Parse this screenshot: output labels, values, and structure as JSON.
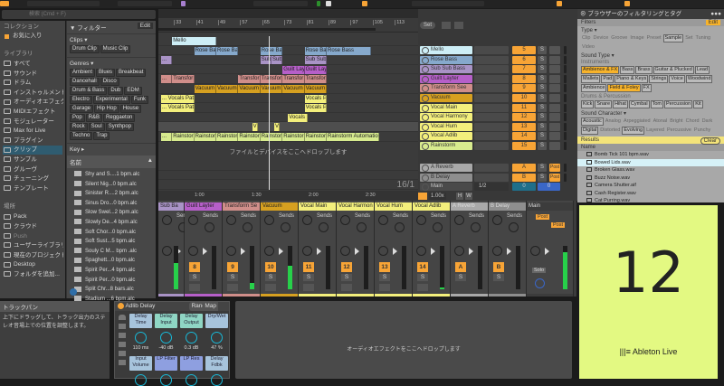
{
  "search": {
    "placeholder": "検索 (Cmd + F)"
  },
  "sidebar": {
    "collections_header": "コレクション",
    "favorites": "お気に入り",
    "library_header": "ライブラリ",
    "library": [
      "すべて",
      "サウンド",
      "ドラム",
      "インストゥルメント",
      "オーディオエフェクト",
      "MIDIエフェクト",
      "モジュレーター",
      "Max for Live",
      "プラグイン",
      "クリップ",
      "サンプル",
      "グルーヴ",
      "チューニング",
      "テンプレート"
    ],
    "selected": "クリップ",
    "places_header": "場所",
    "places": [
      "Pack",
      "クラウド",
      "Push",
      "ユーザーライブラリ",
      "現在のプロジェクト",
      "Desktop",
      "フォルダを追加..."
    ]
  },
  "filter": {
    "title": "フィルター",
    "edit": "Edit",
    "clips_label": "Clips",
    "clips": [
      "Drum Clip",
      "Music Clip"
    ],
    "genres_label": "Genres",
    "genres": [
      "Ambient",
      "Blues",
      "Breakbeat",
      "Dancehall",
      "Disco",
      "Drum & Bass",
      "Dub",
      "EDM",
      "Electro",
      "Experimental",
      "Funk",
      "Garage",
      "Hip Hop",
      "House",
      "Pop",
      "R&B",
      "Reggaeton",
      "Rock",
      "Soul",
      "Synthpop",
      "Techno",
      "Trap"
    ],
    "key_label": "Key",
    "name_header": "名前",
    "files": [
      "Shy and S....1 bpm.alc",
      "Silent Nig...0 bpm.alc",
      "Sinister R....2 bpm.alc",
      "Sinus Dro...0 bpm.alc",
      "Slow Swel...2 bpm.alc",
      "Slowly De...4 bpm.alc",
      "Soft Chor...0 bpm.alc",
      "Soft Sust...5 bpm.alc",
      "Souly C M... bpm .alc",
      "Spaghett...0 bpm.alc",
      "Spirit Per...4 bpm.alc",
      "Spirit Per...0 bpm.alc",
      "Split Chr...8 bars.alc",
      "Stadium ...6 bpm.alc"
    ]
  },
  "arrangement": {
    "bar_ticks": [
      "33",
      "41",
      "49",
      "57",
      "65",
      "73",
      "81",
      "89",
      "97",
      "105",
      "113"
    ],
    "time_ticks": [
      "1:00",
      "1:30",
      "2:00",
      "2:30"
    ],
    "drop_text": "ファイルとデバイスをここへドロップします",
    "position": "16/1",
    "clips": [
      {
        "t": 0,
        "s": 33,
        "e": 48,
        "n": "Mello"
      },
      {
        "t": 1,
        "s": 41,
        "e": 48,
        "n": "Rose Bass"
      },
      {
        "t": 1,
        "s": 49,
        "e": 56,
        "n": "Rose Bass"
      },
      {
        "t": 1,
        "s": 65,
        "e": 72,
        "n": "Rose Bass"
      },
      {
        "t": 1,
        "s": 81,
        "e": 88,
        "n": "Rose Bass"
      },
      {
        "t": 1,
        "s": 89,
        "e": 104,
        "n": "Rose Bass"
      },
      {
        "t": 2,
        "s": 29,
        "e": 32,
        "n": "..."
      },
      {
        "t": 2,
        "s": 65,
        "e": 68,
        "n": "Sub"
      },
      {
        "t": 2,
        "s": 69,
        "e": 72,
        "n": "Sub"
      },
      {
        "t": 2,
        "s": 81,
        "e": 88,
        "n": "Sub Sub"
      },
      {
        "t": 3,
        "s": 73,
        "e": 80,
        "n": "Guilt Lay"
      },
      {
        "t": 3,
        "s": 81,
        "e": 88,
        "n": "Guilt Lay"
      },
      {
        "t": 4,
        "s": 29,
        "e": 32,
        "n": "..."
      },
      {
        "t": 4,
        "s": 33,
        "e": 40,
        "n": "Transfor"
      },
      {
        "t": 4,
        "s": 57,
        "e": 64,
        "n": "Transfor"
      },
      {
        "t": 4,
        "s": 65,
        "e": 72,
        "n": "Transfor"
      },
      {
        "t": 4,
        "s": 73,
        "e": 80,
        "n": "Transfor"
      },
      {
        "t": 4,
        "s": 81,
        "e": 88,
        "n": "Transfor"
      },
      {
        "t": 5,
        "s": 41,
        "e": 48,
        "n": "Vacuum"
      },
      {
        "t": 5,
        "s": 49,
        "e": 56,
        "n": "Vacuum"
      },
      {
        "t": 5,
        "s": 57,
        "e": 64,
        "n": "Vacuum"
      },
      {
        "t": 5,
        "s": 65,
        "e": 72,
        "n": "Vacuum"
      },
      {
        "t": 5,
        "s": 73,
        "e": 80,
        "n": "Vacuum"
      },
      {
        "t": 5,
        "s": 81,
        "e": 88,
        "n": "Vacuum"
      },
      {
        "t": 6,
        "s": 29,
        "e": 40,
        "n": "... Vocals Pat"
      },
      {
        "t": 6,
        "s": 81,
        "e": 88,
        "n": "Vocals Pa"
      },
      {
        "t": 7,
        "s": 29,
        "e": 40,
        "n": "... Vocals Pat"
      },
      {
        "t": 7,
        "s": 81,
        "e": 88,
        "n": "Vocals Pa"
      },
      {
        "t": 8,
        "s": 75,
        "e": 81,
        "n": "Vocals"
      },
      {
        "t": 9,
        "s": 62,
        "e": 63,
        "n": "V"
      },
      {
        "t": 9,
        "s": 70,
        "e": 71,
        "n": "V"
      },
      {
        "t": 10,
        "s": 29,
        "e": 32,
        "n": "..."
      },
      {
        "t": 10,
        "s": 33,
        "e": 40,
        "n": "Rainstor"
      },
      {
        "t": 10,
        "s": 41,
        "e": 48,
        "n": "Rainstor"
      },
      {
        "t": 10,
        "s": 49,
        "e": 56,
        "n": "Rainstor"
      },
      {
        "t": 10,
        "s": 57,
        "e": 64,
        "n": "Rainstor"
      },
      {
        "t": 10,
        "s": 65,
        "e": 72,
        "n": "Rainstor"
      },
      {
        "t": 10,
        "s": 73,
        "e": 80,
        "n": "Rainstor"
      },
      {
        "t": 10,
        "s": 81,
        "e": 88,
        "n": "Rainstor"
      },
      {
        "t": 10,
        "s": 89,
        "e": 107,
        "n": "Rainstorm Automation"
      }
    ]
  },
  "tracks": [
    {
      "name": "Mello",
      "num": "5",
      "color": "#cdeef6"
    },
    {
      "name": "Rose Bass",
      "num": "6",
      "color": "#86a9cc"
    },
    {
      "name": "Sub Sub Bass",
      "num": "7",
      "color": "#a993c6"
    },
    {
      "name": "Guilt Layter",
      "num": "8",
      "color": "#b65fc9"
    },
    {
      "name": "Transform See",
      "num": "9",
      "color": "#d08e8a"
    },
    {
      "name": "Vacuum",
      "num": "10",
      "color": "#d6a020"
    },
    {
      "name": "Vocal Main",
      "num": "11",
      "color": "#f3ef7c"
    },
    {
      "name": "Vocal Harmony",
      "num": "12",
      "color": "#f3ef7c"
    },
    {
      "name": "Vocal Hum",
      "num": "13",
      "color": "#f3ef7c"
    },
    {
      "name": "Vocal Adlib",
      "num": "14",
      "color": "#f3ef7c"
    },
    {
      "name": "Rainstorm",
      "num": "15",
      "color": "#d7eb8e"
    }
  ],
  "returns": [
    {
      "name": "A Reverb",
      "num": "A",
      "color": "#a9a9a9"
    },
    {
      "name": "B Delay",
      "num": "B",
      "color": "#8e8e8e"
    }
  ],
  "main": {
    "name": "Main",
    "routing": "1/2",
    "vol": "0",
    "pan": "0"
  },
  "session_controls": {
    "set": "Set",
    "zoom": "1.00x",
    "h": "H",
    "w": "W",
    "solo": "S",
    "post": "Post"
  },
  "mixer": {
    "sends_label": "Sends",
    "send_a": "A",
    "send_b": "B",
    "solo": "S",
    "post": "Post",
    "solo_main": "Solo",
    "strips": [
      {
        "name": "Sub Ba",
        "num": "",
        "color": "#a993c6",
        "level": 0.6
      },
      {
        "name": "Guilt Layter",
        "num": "8",
        "color": "#b65fc9",
        "level": 0
      },
      {
        "name": "Transform Se",
        "num": "9",
        "color": "#d08e8a",
        "level": 0.15
      },
      {
        "name": "Vacuum",
        "num": "10",
        "color": "#d6a020",
        "level": 0.55
      },
      {
        "name": "Vocal Main",
        "num": "11",
        "color": "#f3ef7c",
        "level": 0
      },
      {
        "name": "Vocal Harmon",
        "num": "12",
        "color": "#f3ef7c",
        "level": 0
      },
      {
        "name": "Vocal Hum",
        "num": "13",
        "color": "#f3ef7c",
        "level": 0
      },
      {
        "name": "Vocal Adlib",
        "num": "14",
        "color": "#f3ef7c",
        "level": 0.05
      },
      {
        "name": "A Reverb",
        "num": "A",
        "color": "#a9a9a9",
        "level": 0
      },
      {
        "name": "B Delay",
        "num": "B",
        "color": "#8e8e8e",
        "level": 0
      },
      {
        "name": "Main",
        "num": "",
        "color": "#3c3c3c",
        "level": 0.85
      }
    ]
  },
  "right_browser": {
    "title": "ブラウザーのフィルタリングとタグ",
    "filters": "Filters",
    "edit": "Edit",
    "type_label": "Type",
    "types": [
      "Clip",
      "Device",
      "Groove",
      "Image",
      "Preset",
      "Sample",
      "Set",
      "Tuning",
      "Video"
    ],
    "type_selected": "Sample",
    "sound_type_label": "Sound Type",
    "instruments_label": "Instruments",
    "instruments": [
      "Ambience & FX",
      "Bass",
      "Brass",
      "Guitar & Plucked",
      "Lead",
      "Mallets",
      "Pad",
      "Piano & Keys",
      "Strings",
      "Voice",
      "Woodwind",
      "Ambience",
      "Field & Foley",
      "FX"
    ],
    "instruments_orange": [
      "Ambience & FX",
      "Field & Foley"
    ],
    "drums_label": "Drums & Percussion",
    "drums": [
      "Kick",
      "Snare",
      "Hihat",
      "Cymbal",
      "Tom",
      "Percussion",
      "Kit"
    ],
    "character_label": "Sound Character",
    "character": [
      "Acoustic",
      "Analog",
      "Arpeggiated",
      "Atonal",
      "Bright",
      "Chord",
      "Dark",
      "Digital",
      "Distorted",
      "Evolving",
      "Layered",
      "Percussive",
      "Punchy",
      "Reverse",
      "Rhythmic",
      "Sampled",
      "Snappy",
      "Soft"
    ],
    "character_on": [
      "Acoustic",
      "Digital",
      "Evolving",
      "Rhythmic"
    ],
    "results": "Results",
    "clear": "Clear",
    "name_header": "Name",
    "files": [
      "Bomb Tick 101 bpm.wav",
      "Bowed Lids.wav",
      "Broken Glass.wav",
      "Buzz Noise.wav",
      "Camera Shutter.aif",
      "Cash Register.wav",
      "Cat Purring.wav"
    ],
    "selected_file": "Bowed Lids.wav"
  },
  "splash": {
    "version": "12",
    "product": "Ableton Live"
  },
  "info": {
    "title": "トラックパン",
    "text": "上下にドラッグして、トラック出力のステレオ音場上での位置を調整します。"
  },
  "device": {
    "name": "Adlib Delay",
    "rand": "Rand",
    "map": "Map",
    "params": [
      {
        "n": "Delay Time",
        "v": "110 ms",
        "c": "#a7c4dc"
      },
      {
        "n": "Delay Input",
        "v": "-40 dB",
        "c": "#8fd6c4"
      },
      {
        "n": "Delay Output",
        "v": "0.3 dB",
        "c": "#8fd6c4"
      },
      {
        "n": "Dry/Wet",
        "v": "47 %",
        "c": "#a7c4dc"
      },
      {
        "n": "Input Volume",
        "v": "",
        "c": "#a7c4dc"
      },
      {
        "n": "LP Filter",
        "v": "",
        "c": "#8e9fe0"
      },
      {
        "n": "LP Res",
        "v": "",
        "c": "#8e9fe0"
      },
      {
        "n": "Delay Fdbk",
        "v": "",
        "c": "#a7c4dc"
      }
    ]
  },
  "drop_effects": "オーディオエフェクトをここへドロップします"
}
